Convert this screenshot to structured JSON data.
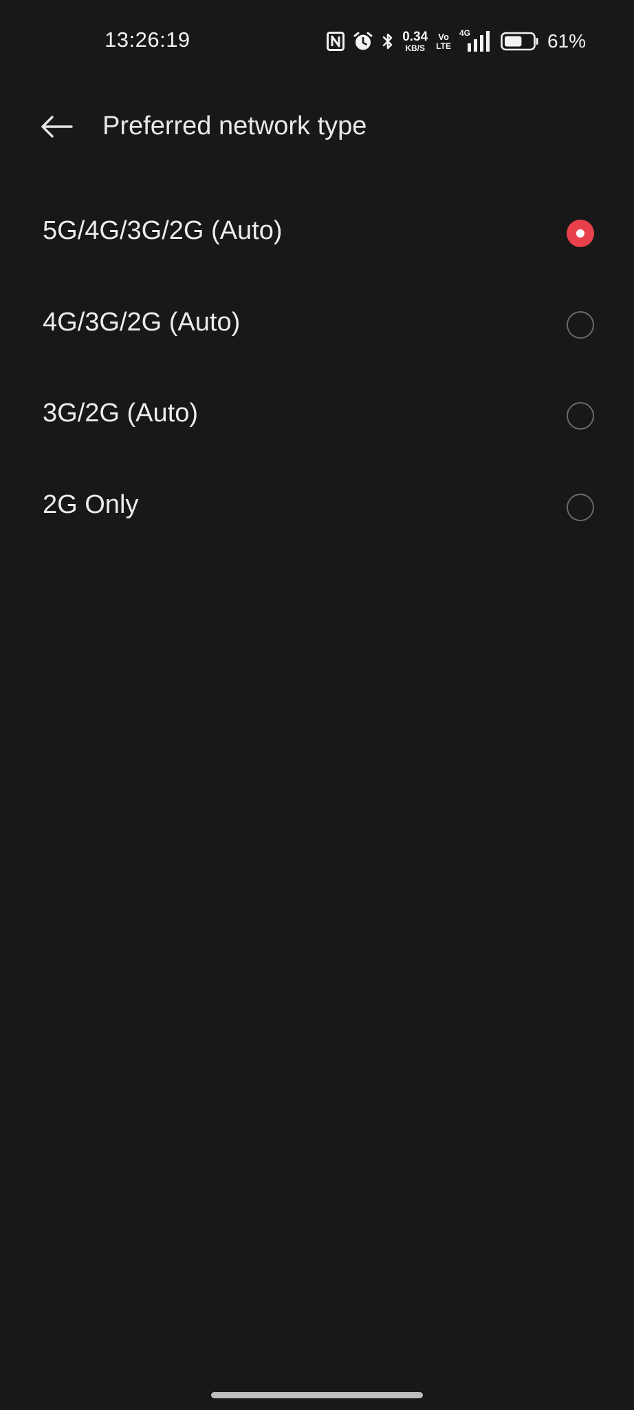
{
  "status_bar": {
    "time": "13:26:19",
    "net_speed_value": "0.34",
    "net_speed_unit": "KB/S",
    "volte_top": "Vo",
    "volte_bottom": "LTE",
    "signal_type": "4G",
    "battery_percent": "61%",
    "battery_level": 0.61,
    "icons": [
      "nfc-icon",
      "alarm-icon",
      "bluetooth-icon",
      "signal-icon",
      "battery-icon"
    ]
  },
  "app_bar": {
    "back_icon": "arrow-left-icon",
    "title": "Preferred network type"
  },
  "options": [
    {
      "label": "5G/4G/3G/2G (Auto)",
      "selected": true
    },
    {
      "label": "4G/3G/2G (Auto)",
      "selected": false
    },
    {
      "label": "3G/2G (Auto)",
      "selected": false
    },
    {
      "label": "2G Only",
      "selected": false
    }
  ],
  "colors": {
    "background": "#181818",
    "accent": "#e8414b",
    "text": "#ececec",
    "radio_border": "#6a6a6a"
  }
}
